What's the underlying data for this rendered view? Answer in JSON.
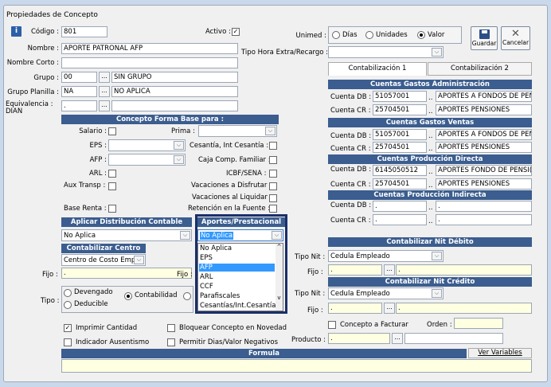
{
  "window_title": "Propiedades de Concepto",
  "codigo": {
    "label": "Código :",
    "value": "801"
  },
  "activo": {
    "label": "Activo :",
    "checked": true
  },
  "unimed": {
    "label": "Unimed :",
    "options": [
      "Días",
      "Unidades",
      "Valor"
    ],
    "selected": "Valor"
  },
  "nombre": {
    "label": "Nombre :",
    "value": "APORTE PATRONAL AFP"
  },
  "tipo_hora": {
    "label": "Tipo Hora Extra/Recargo :",
    "value": ""
  },
  "nombre_corto": {
    "label": "Nombre Corto :",
    "value": ""
  },
  "grupo": {
    "label": "Grupo :",
    "code": "00",
    "name": "SIN GRUPO"
  },
  "grupo_planilla": {
    "label": "Grupo Planilla :",
    "code": "NA",
    "name": "NO APLICA"
  },
  "equivalencia": {
    "label1": "Equivalencia :",
    "label2": "DIAN",
    "value": "."
  },
  "buttons": {
    "guardar": "Guardar",
    "cancelar": "Cancelar",
    "ellipsis": "..."
  },
  "tabs": [
    "Contabilización 1",
    "Contabilización 2"
  ],
  "cuentas": {
    "admin_title": "Cuentas Gastos Administración",
    "ventas_title": "Cuentas Gastos Ventas",
    "prod_dir_title": "Cuentas Producción Directa",
    "prod_ind_title": "Cuentas Producción Indirecta",
    "db_label": "Cuenta DB :",
    "cr_label": "Cuenta CR :",
    "admin": {
      "db": "51057001",
      "db_name": "APORTES A FONDOS DE PEN",
      "cr": "25704501",
      "cr_name": "APORTES PENSIONES"
    },
    "ventas": {
      "db": "51057001",
      "db_name": "APORTES A FONDOS DE PEN",
      "cr": "25704501",
      "cr_name": "APORTES PENSIONES"
    },
    "prod_dir": {
      "db": "6145050512",
      "db_name": "APORTES FONDO DE PENSI(",
      "cr": "25704501",
      "cr_name": "APORTES PENSIONES"
    },
    "prod_ind": {
      "db": ".",
      "db_name": ".",
      "cr": ".",
      "cr_name": "."
    }
  },
  "forma_base": {
    "title": "Concepto Forma Base para :",
    "salario": "Salario :",
    "prima": "Prima :",
    "eps": "EPS :",
    "cesantia": "Cesantía, Int Cesantía :",
    "afp": "AFP :",
    "caja": "Caja Comp. Familiar :",
    "arl": "ARL :",
    "icbf": "ICBF/SENA :",
    "aux": "Aux Transp :",
    "vac_disfrutar": "Vacaciones a Disfrutar :",
    "vac_liquidar": "Vacaciones al Liquidar :",
    "base_renta": "Base Renta :",
    "retencion": "Retención en la Fuente :"
  },
  "distribucion": {
    "title": "Aplicar Distribución Contable",
    "value": "No Aplica"
  },
  "aportes": {
    "title": "Aportes/Prestacional",
    "value": "No Aplica",
    "options": [
      "No Aplica",
      "EPS",
      "AFP",
      "ARL",
      "CCF",
      "Parafiscales",
      "Cesantías/Int.Cesantías"
    ],
    "highlighted": "AFP"
  },
  "centro": {
    "title": "Contabilizar Centro",
    "value": "Centro de Costo Emple"
  },
  "fijo_label": "Fijo :",
  "fijo_value": ".",
  "tipo": {
    "label": "Tipo :",
    "devengado": "Devengado",
    "deducible": "Deducible",
    "contabilidad": "Contabilidad"
  },
  "nit_debito": {
    "title": "Contabilizar Nit Débito",
    "tipo_label": "Tipo Nit :",
    "tipo_value": "Cedula Empleado",
    "fijo_label": "Fijo :",
    "fijo_code": ".",
    "fijo_name": "."
  },
  "nit_credito": {
    "title": "Contabilizar Nit Crédito",
    "tipo_label": "Tipo Nit :",
    "tipo_value": "Cedula Empleado",
    "fijo_label": "Fijo :",
    "fijo_code": ".",
    "fijo_name": "."
  },
  "imprimir": {
    "label": "Imprimir Cantidad",
    "checked": true
  },
  "bloquear": {
    "label": "Bloquear Concepto en Novedad",
    "checked": false
  },
  "facturar": {
    "label": "Concepto a Facturar",
    "checked": false
  },
  "orden": {
    "label": "Orden :",
    "value": ""
  },
  "ausentismo": {
    "label": "Indicador Ausentismo",
    "checked": false
  },
  "permitir": {
    "label": "Permitir Dias/Valor Negativos",
    "checked": false
  },
  "producto": {
    "label": "Producto :",
    "code": ".",
    "name": ""
  },
  "formula": {
    "title": "Formula",
    "ver": "Ver Variables",
    "value": ""
  }
}
